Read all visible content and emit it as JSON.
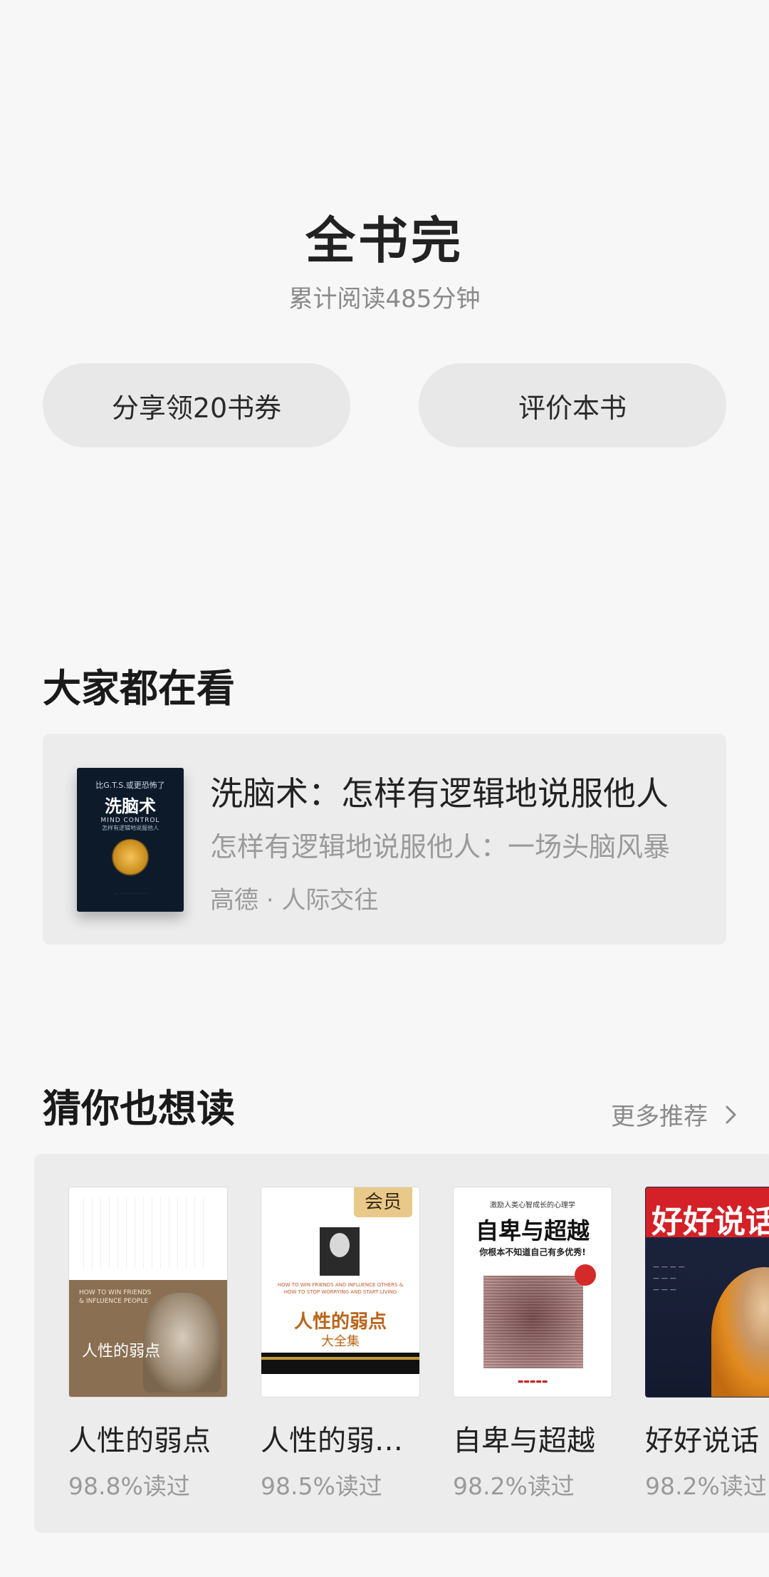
{
  "header": {
    "title": "全书完",
    "reading_time": "累计阅读485分钟"
  },
  "actions": {
    "share_label": "分享领20书券",
    "rate_label": "评价本书"
  },
  "trending": {
    "section_title": "大家都在看",
    "book": {
      "title": "洗脑术：怎样有逻辑地说服他人",
      "description": "怎样有逻辑地说服他人：一场头脑风暴",
      "meta": "高德 · 人际交往",
      "cover": {
        "top_line": "比G.T.S.或更恐怖了",
        "title": "洗脑术",
        "english": "MIND CONTROL",
        "subtitle": "怎样有逻辑地说服他人"
      }
    }
  },
  "recommend": {
    "section_title": "猜你也想读",
    "more_label": "更多推荐",
    "items": [
      {
        "name": "人性的弱点",
        "read_rate": "98.8%读过",
        "cover_title": "人性的弱点",
        "cover_english": "HOW TO WIN FRIENDS & INFLUENCE PEOPLE"
      },
      {
        "name": "人性的弱…",
        "read_rate": "98.5%读过",
        "badge": "会员",
        "cover_title": "人性的弱点",
        "cover_subtitle": "大全集",
        "cover_english": "HOW TO WIN FRIENDS AND INFLUENCE OTHERS & HOW TO STOP WORRYING AND START LIVING"
      },
      {
        "name": "自卑与超越",
        "read_rate": "98.2%读过",
        "cover_top": "激励人类心智成长的心理学",
        "cover_title": "自卑与超越",
        "cover_subtitle": "你根本不知道自己有多优秀!"
      },
      {
        "name": "好好说话",
        "read_rate": "98.2%读过",
        "cover_title": "好好说话"
      }
    ]
  },
  "icons": {
    "more": "chevron-right-icon"
  },
  "colors": {
    "background": "#f7f7f7",
    "card": "#ececec",
    "pill": "#e8e8e8",
    "muted_text": "#9a9a9a",
    "vip_badge": "#e9c98a"
  }
}
